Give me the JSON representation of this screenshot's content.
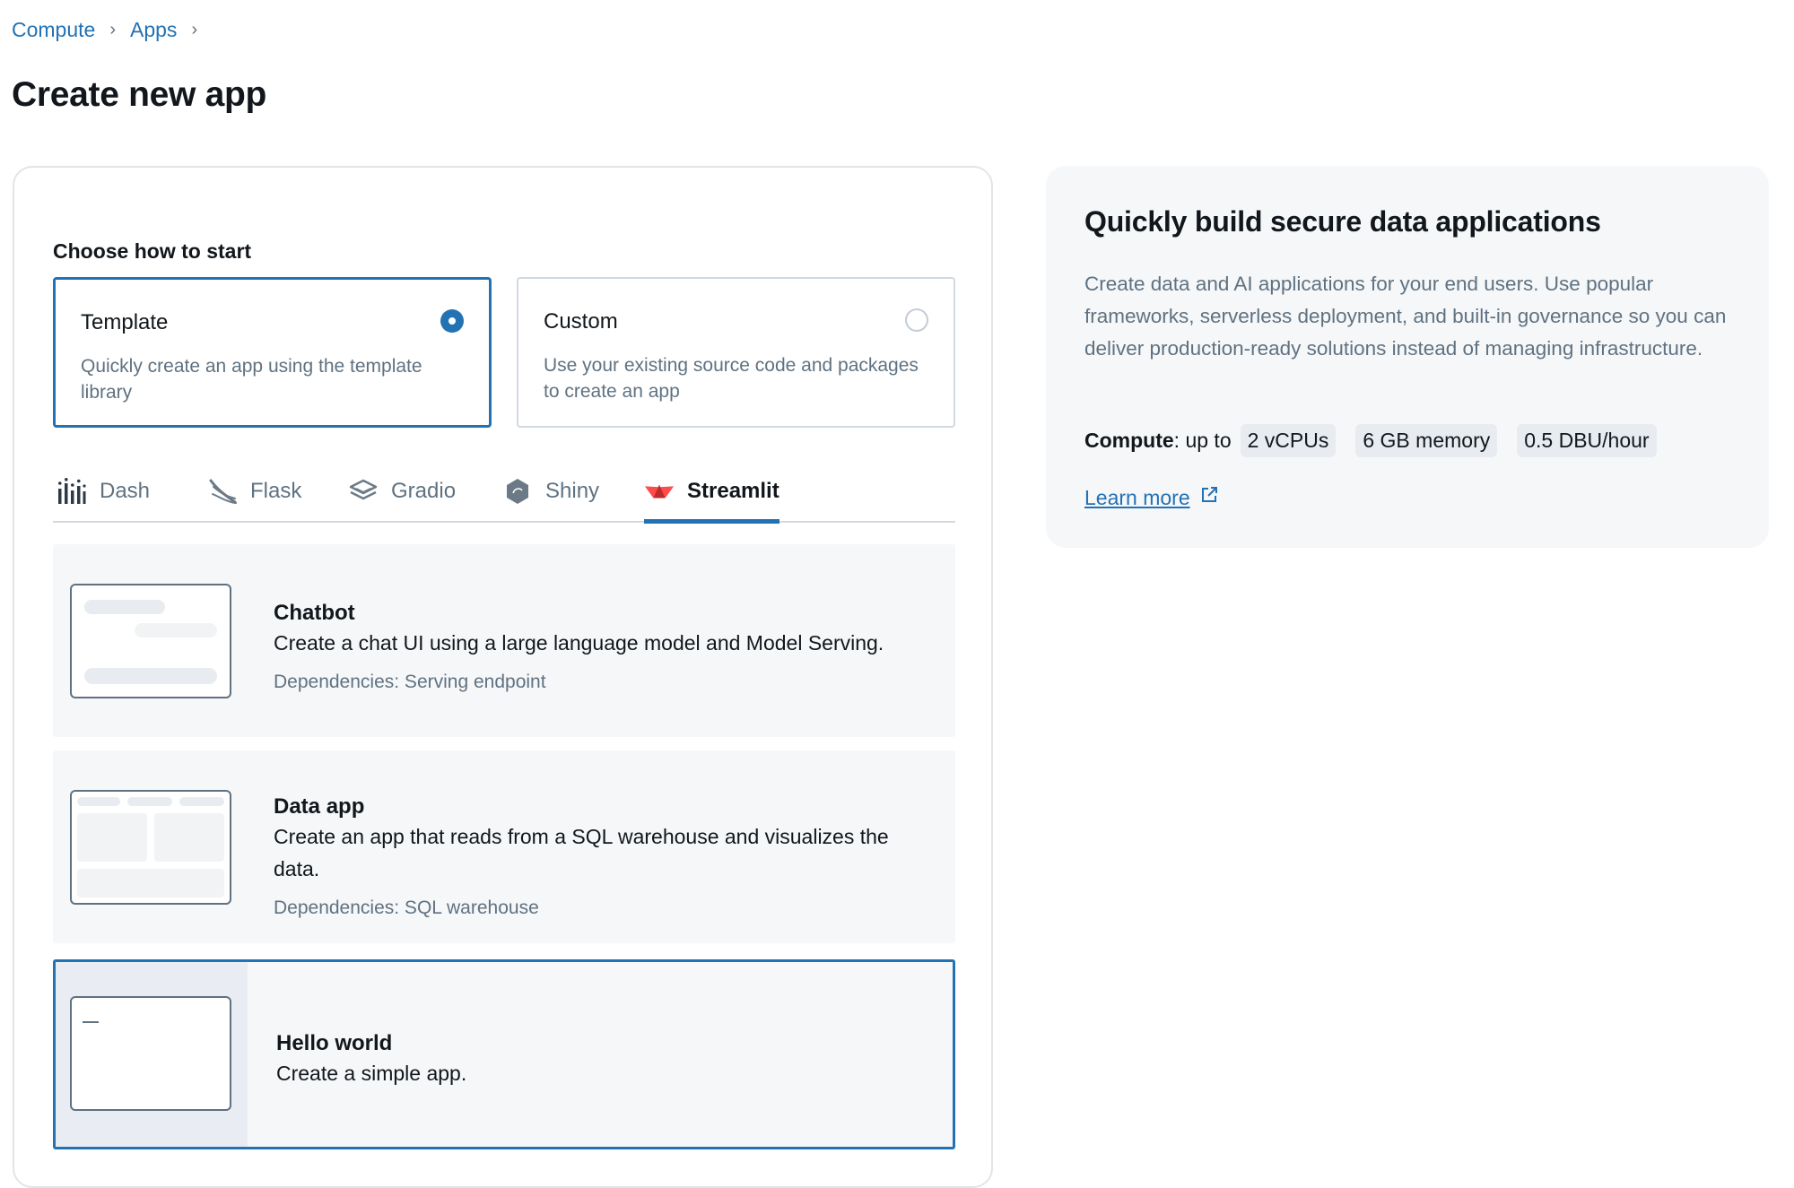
{
  "breadcrumb": {
    "items": [
      "Compute",
      "Apps"
    ],
    "separator": "›"
  },
  "page_title": "Create new app",
  "start": {
    "label": "Choose how to start",
    "options": [
      {
        "title": "Template",
        "description": "Quickly create an app using the template library",
        "selected": true
      },
      {
        "title": "Custom",
        "description": "Use your existing source code and packages to create an app",
        "selected": false
      }
    ]
  },
  "tabs": [
    {
      "label": "Dash",
      "icon": "dash-logo-icon"
    },
    {
      "label": "Flask",
      "icon": "flask-logo-icon"
    },
    {
      "label": "Gradio",
      "icon": "gradio-logo-icon"
    },
    {
      "label": "Shiny",
      "icon": "shiny-logo-icon"
    },
    {
      "label": "Streamlit",
      "icon": "streamlit-logo-icon",
      "active": true
    }
  ],
  "templates": [
    {
      "title": "Chatbot",
      "description": "Create a chat UI using a large language model and Model Serving.",
      "dependencies": "Dependencies: Serving endpoint"
    },
    {
      "title": "Data app",
      "description": "Create an app that reads from a SQL warehouse and visualizes the data.",
      "dependencies": "Dependencies: SQL warehouse"
    },
    {
      "title": "Hello world",
      "description": "Create a simple app.",
      "selected": true
    }
  ],
  "info": {
    "title": "Quickly build secure data applications",
    "description": "Create data and AI applications for your end users. Use popular frameworks, serverless deployment, and built-in governance so you can deliver production-ready solutions instead of managing infrastructure.",
    "compute_label": "Compute",
    "compute_prefix": ": up to",
    "specs": [
      "2 vCPUs",
      "6 GB memory",
      "0.5 DBU/hour"
    ],
    "learn_more": "Learn more"
  },
  "colors": {
    "accent": "#2272b4",
    "text": "#11171c",
    "muted": "#5f7281",
    "panel": "#f6f7f9",
    "streamlit": "#ff4b4b"
  }
}
